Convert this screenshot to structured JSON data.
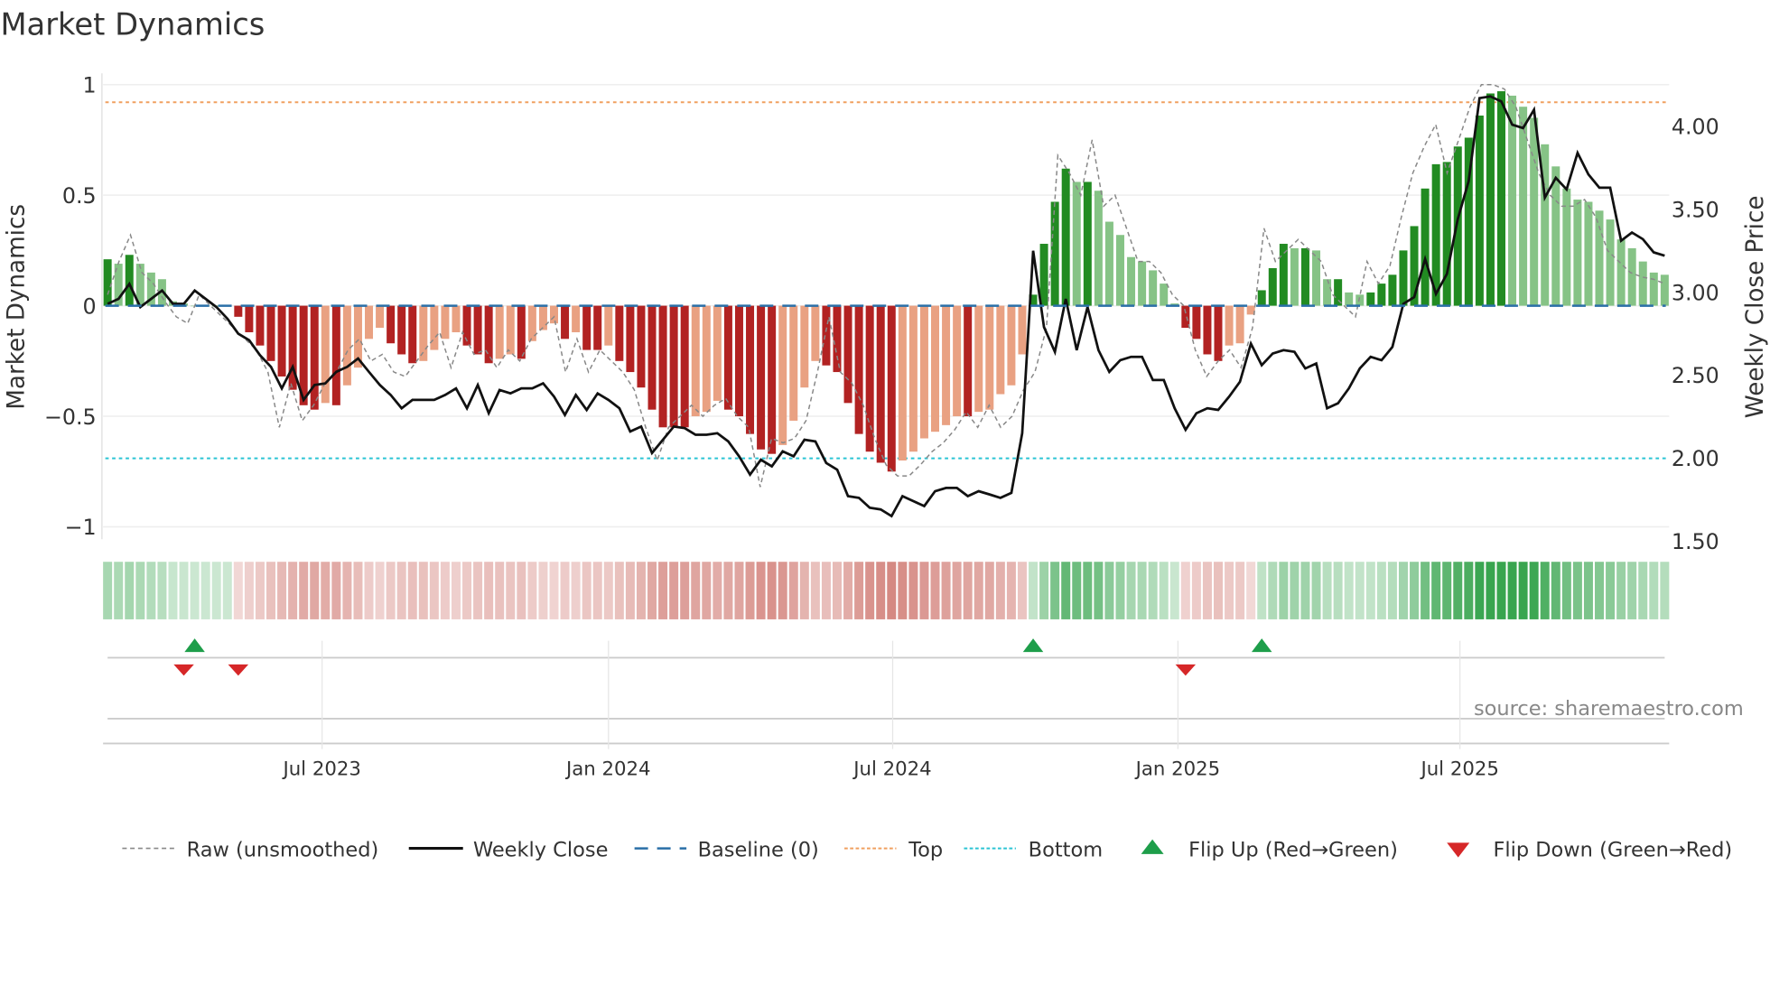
{
  "chart_data": {
    "type": "bar",
    "title": "Market Dynamics",
    "ylabel": "Market Dynamics",
    "y2label": "Weekly Close Price",
    "ylim": [
      -1.05,
      1.03
    ],
    "y2lim": [
      1.5,
      4.25
    ],
    "yticks": [
      {
        "v": 1,
        "label": "1"
      },
      {
        "v": 0.5,
        "label": "0.5"
      },
      {
        "v": 0,
        "label": "0"
      },
      {
        "v": -0.5,
        "label": "−0.5"
      },
      {
        "v": -1,
        "label": "−1"
      }
    ],
    "y2ticks": [
      {
        "v": 4.0,
        "label": "4.00"
      },
      {
        "v": 3.5,
        "label": "3.50"
      },
      {
        "v": 3.0,
        "label": "3.00"
      },
      {
        "v": 2.5,
        "label": "2.50"
      },
      {
        "v": 2.0,
        "label": "2.00"
      },
      {
        "v": 1.5,
        "label": "1.50"
      }
    ],
    "xticks": [
      {
        "week": 19.7,
        "label": "Jul 2023"
      },
      {
        "week": 46,
        "label": "Jan 2024"
      },
      {
        "week": 72.1,
        "label": "Jul 2024"
      },
      {
        "week": 98.3,
        "label": "Jan 2025"
      },
      {
        "week": 124.2,
        "label": "Jul 2025"
      }
    ],
    "top_level": 0.92,
    "bottom_level": -0.69,
    "baseline": 0,
    "smoothed": [
      0.21,
      0.19,
      0.23,
      0.19,
      0.15,
      0.12,
      0.02,
      0.01,
      0,
      0,
      0,
      0,
      -0.05,
      -0.12,
      -0.18,
      -0.25,
      -0.32,
      -0.38,
      -0.45,
      -0.47,
      -0.44,
      -0.45,
      -0.36,
      -0.28,
      -0.15,
      -0.1,
      -0.17,
      -0.22,
      -0.26,
      -0.25,
      -0.2,
      -0.15,
      -0.12,
      -0.18,
      -0.22,
      -0.26,
      -0.24,
      -0.22,
      -0.24,
      -0.16,
      -0.11,
      -0.08,
      -0.15,
      -0.12,
      -0.2,
      -0.2,
      -0.18,
      -0.25,
      -0.3,
      -0.37,
      -0.47,
      -0.55,
      -0.55,
      -0.55,
      -0.5,
      -0.48,
      -0.43,
      -0.47,
      -0.5,
      -0.58,
      -0.65,
      -0.67,
      -0.63,
      -0.52,
      -0.37,
      -0.25,
      -0.27,
      -0.3,
      -0.44,
      -0.58,
      -0.66,
      -0.71,
      -0.75,
      -0.7,
      -0.66,
      -0.6,
      -0.57,
      -0.54,
      -0.5,
      -0.5,
      -0.48,
      -0.47,
      -0.4,
      -0.36,
      -0.22,
      0.05,
      0.28,
      0.47,
      0.62,
      0.56,
      0.56,
      0.52,
      0.38,
      0.32,
      0.22,
      0.2,
      0.16,
      0.1,
      0.01,
      -0.1,
      -0.15,
      -0.22,
      -0.25,
      -0.18,
      -0.17,
      -0.04,
      0.07,
      0.17,
      0.28,
      0.26,
      0.26,
      0.25,
      0.12,
      0.12,
      0.06,
      0.05,
      0.06,
      0.1,
      0.14,
      0.25,
      0.36,
      0.53,
      0.64,
      0.65,
      0.72,
      0.76,
      0.86,
      0.96,
      0.97,
      0.95,
      0.9,
      0.85,
      0.73,
      0.63,
      0.53,
      0.48,
      0.47,
      0.43,
      0.39,
      0.3,
      0.26,
      0.2,
      0.15,
      0.14
    ],
    "raw": [
      0.05,
      0.2,
      0.32,
      0.15,
      0.1,
      0.02,
      -0.05,
      -0.08,
      0.05,
      0,
      -0.05,
      -0.1,
      -0.15,
      -0.2,
      -0.3,
      -0.55,
      -0.35,
      -0.52,
      -0.45,
      -0.35,
      -0.3,
      -0.2,
      -0.15,
      -0.25,
      -0.22,
      -0.3,
      -0.32,
      -0.25,
      -0.18,
      -0.12,
      -0.28,
      -0.12,
      -0.22,
      -0.2,
      -0.28,
      -0.2,
      -0.25,
      -0.15,
      -0.1,
      -0.05,
      -0.3,
      -0.15,
      -0.3,
      -0.2,
      -0.25,
      -0.3,
      -0.38,
      -0.55,
      -0.7,
      -0.55,
      -0.5,
      -0.45,
      -0.5,
      -0.45,
      -0.42,
      -0.5,
      -0.55,
      -0.82,
      -0.6,
      -0.62,
      -0.6,
      -0.52,
      -0.3,
      -0.05,
      -0.3,
      -0.35,
      -0.45,
      -0.6,
      -0.72,
      -0.77,
      -0.77,
      -0.72,
      -0.66,
      -0.62,
      -0.56,
      -0.48,
      -0.55,
      -0.45,
      -0.55,
      -0.5,
      -0.38,
      -0.3,
      -0.1,
      0.68,
      0.6,
      0.5,
      0.75,
      0.45,
      0.5,
      0.35,
      0.2,
      0.2,
      0.15,
      0.05,
      0,
      -0.2,
      -0.32,
      -0.25,
      -0.2,
      -0.28,
      -0.1,
      0.35,
      0.2,
      0.25,
      0.3,
      0.25,
      0.2,
      0.05,
      0,
      -0.05,
      0.2,
      0.1,
      0.18,
      0.4,
      0.6,
      0.72,
      0.82,
      0.6,
      0.75,
      0.9,
      1.0,
      1.0,
      0.98,
      0.9,
      0.75,
      0.6,
      0.5,
      0.45,
      0.45,
      0.48,
      0.4,
      0.25,
      0.2,
      0.15,
      0.13,
      0.12,
      0.1
    ],
    "weekly_close": [
      2.93,
      2.96,
      3.05,
      2.91,
      2.96,
      3.01,
      2.93,
      2.93,
      3.01,
      2.96,
      2.91,
      2.84,
      2.75,
      2.71,
      2.62,
      2.55,
      2.42,
      2.55,
      2.35,
      2.44,
      2.45,
      2.52,
      2.55,
      2.6,
      2.52,
      2.44,
      2.38,
      2.3,
      2.35,
      2.35,
      2.35,
      2.38,
      2.42,
      2.3,
      2.44,
      2.27,
      2.41,
      2.39,
      2.42,
      2.42,
      2.45,
      2.37,
      2.26,
      2.38,
      2.29,
      2.39,
      2.35,
      2.3,
      2.16,
      2.19,
      2.03,
      2.11,
      2.19,
      2.18,
      2.14,
      2.14,
      2.15,
      2.1,
      2.01,
      1.9,
      1.99,
      1.95,
      2.04,
      2.01,
      2.11,
      2.1,
      1.97,
      1.93,
      1.77,
      1.76,
      1.7,
      1.69,
      1.65,
      1.77,
      1.74,
      1.71,
      1.8,
      1.82,
      1.82,
      1.77,
      1.8,
      1.78,
      1.76,
      1.79,
      2.15,
      3.25,
      2.79,
      2.64,
      2.96,
      2.65,
      2.91,
      2.65,
      2.52,
      2.59,
      2.61,
      2.61,
      2.47,
      2.47,
      2.3,
      2.17,
      2.27,
      2.3,
      2.29,
      2.37,
      2.46,
      2.69,
      2.56,
      2.63,
      2.65,
      2.64,
      2.54,
      2.57,
      2.3,
      2.33,
      2.42,
      2.54,
      2.61,
      2.59,
      2.67,
      2.93,
      2.97,
      3.2,
      2.99,
      3.11,
      3.44,
      3.67,
      4.17,
      4.18,
      4.15,
      4.01,
      3.99,
      4.1,
      3.57,
      3.69,
      3.62,
      3.84,
      3.71,
      3.63,
      3.63,
      3.31,
      3.36,
      3.32,
      3.24,
      3.22
    ],
    "flips": [
      {
        "type": "up",
        "week": 8
      },
      {
        "type": "down",
        "week": 7
      },
      {
        "type": "down",
        "week": 12
      },
      {
        "type": "up",
        "week": 85
      },
      {
        "type": "down",
        "week": 99
      },
      {
        "type": "up",
        "week": 106
      }
    ],
    "legend": {
      "raw": "Raw (unsmoothed)",
      "close": "Weekly Close",
      "baseline": "Baseline (0)",
      "top": "Top",
      "bottom": "Bottom",
      "flip_up": "Flip Up (Red→Green)",
      "flip_down": "Flip Down (Green→Red)"
    },
    "legend_placement": "bottom",
    "source": "source: sharemaestro.com",
    "colors": {
      "green_dark": "#228b22",
      "green_light": "#86c386",
      "red_dark": "#b22222",
      "red_light": "#e9a182",
      "top": "#f0a060",
      "bottom": "#2bc4d4",
      "baseline": "#2a6fa8",
      "flip_up": "#1e9e4a",
      "flip_down": "#d62728"
    }
  }
}
